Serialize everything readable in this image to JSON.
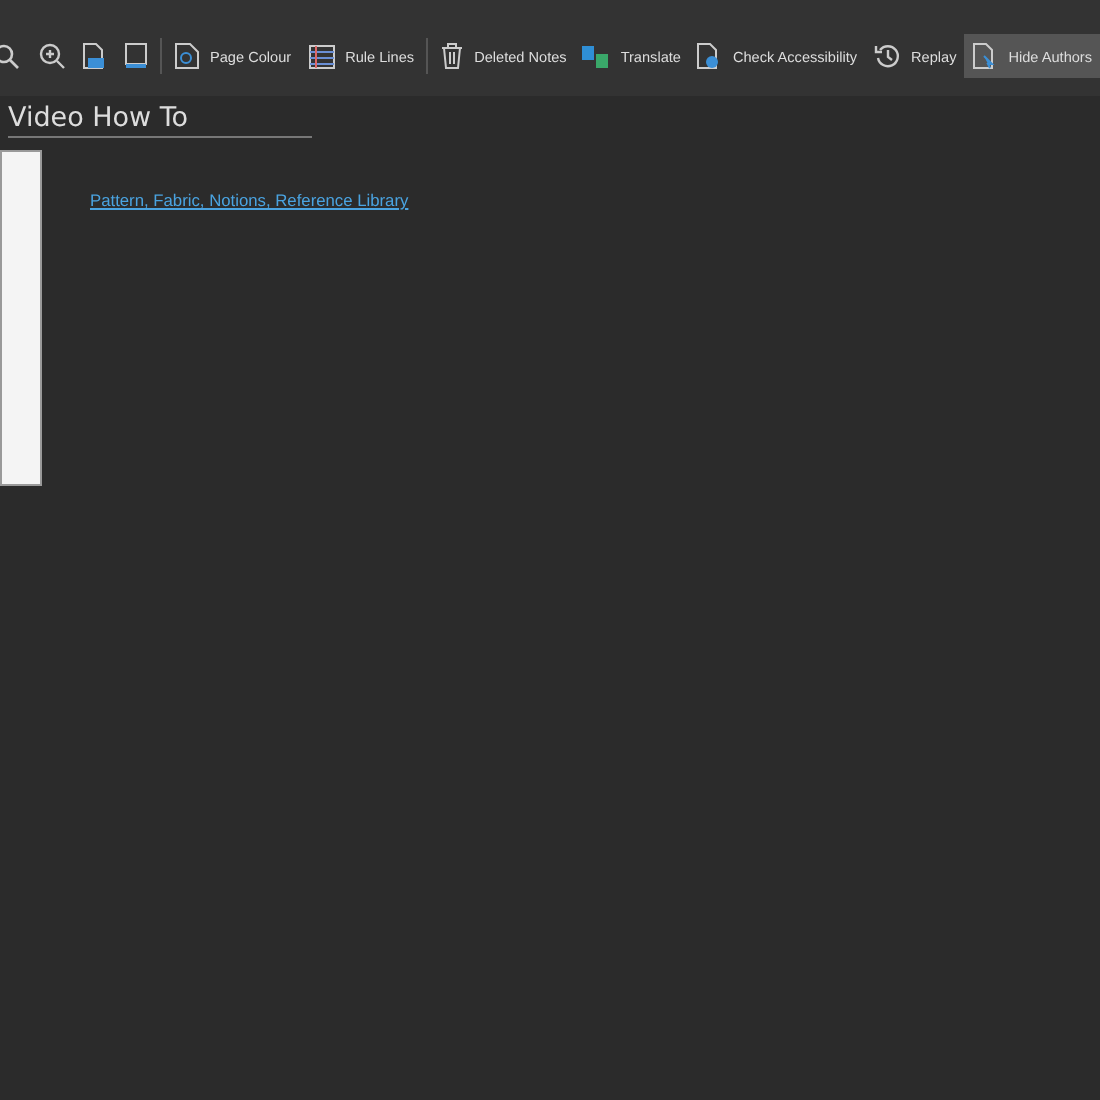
{
  "toolbar": {
    "icon_buttons": [
      {
        "kind": "search"
      },
      {
        "kind": "zoom-in"
      },
      {
        "kind": "page"
      },
      {
        "kind": "frame"
      }
    ],
    "buttons": [
      {
        "kind": "palette",
        "label": "Page Colour",
        "selected": false
      },
      {
        "kind": "lines",
        "label": "Rule Lines",
        "selected": false
      },
      {
        "kind": "trash",
        "label": "Deleted Notes",
        "selected": false
      },
      {
        "kind": "translate",
        "label": "Translate",
        "selected": false
      },
      {
        "kind": "check",
        "label": "Check Accessibility",
        "selected": false
      },
      {
        "kind": "history",
        "label": "Replay",
        "selected": false
      },
      {
        "kind": "author",
        "label": "Hide Authors",
        "selected": true
      }
    ]
  },
  "page": {
    "title": "Video How To",
    "link": "Pattern, Fabric, Notions, Reference Library"
  }
}
